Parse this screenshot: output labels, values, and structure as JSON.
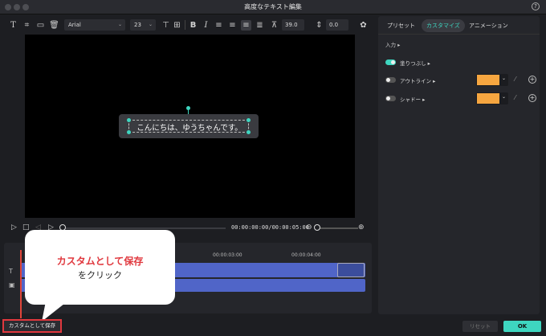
{
  "window": {
    "title": "高度なテキスト編集",
    "help_icon": "?"
  },
  "toolbar": {
    "font": "Arial",
    "size": "23",
    "char_spacing": "39.0",
    "line_spacing": "0.0",
    "icons": [
      "text-tool-icon",
      "crop-icon",
      "image-icon",
      "trash-icon",
      "align-top-icon",
      "align-middle-icon",
      "align-bottom-icon",
      "bold-icon",
      "italic-icon",
      "align-left-icon",
      "align-center-icon",
      "align-right-icon",
      "justify-icon",
      "char-spacing-icon",
      "line-spacing-icon",
      "ai-icon"
    ]
  },
  "preview": {
    "text": "こんにちは、ゆうちゃんです。"
  },
  "player": {
    "timecode": "00:00:00:00/00:00:05:00"
  },
  "timeline": {
    "ruler": [
      "00:00:03:00",
      "00:00:04:00"
    ]
  },
  "callout": {
    "line1": "カスタムとして保存",
    "line2": "をクリック"
  },
  "panel": {
    "tabs": [
      "プリセット",
      "カスタマイズ",
      "アニメーション"
    ],
    "active_tab": "カスタマイズ",
    "section_label": "入力",
    "rows": [
      {
        "label": "塗りつぶし",
        "enabled": true
      },
      {
        "label": "アウトライン",
        "enabled": false,
        "color": "#f6a640"
      },
      {
        "label": "シャドー",
        "enabled": false,
        "color": "#f6a640"
      }
    ]
  },
  "footer": {
    "save_custom": "カスタムとして保存",
    "reset": "リセット",
    "ok": "OK"
  }
}
